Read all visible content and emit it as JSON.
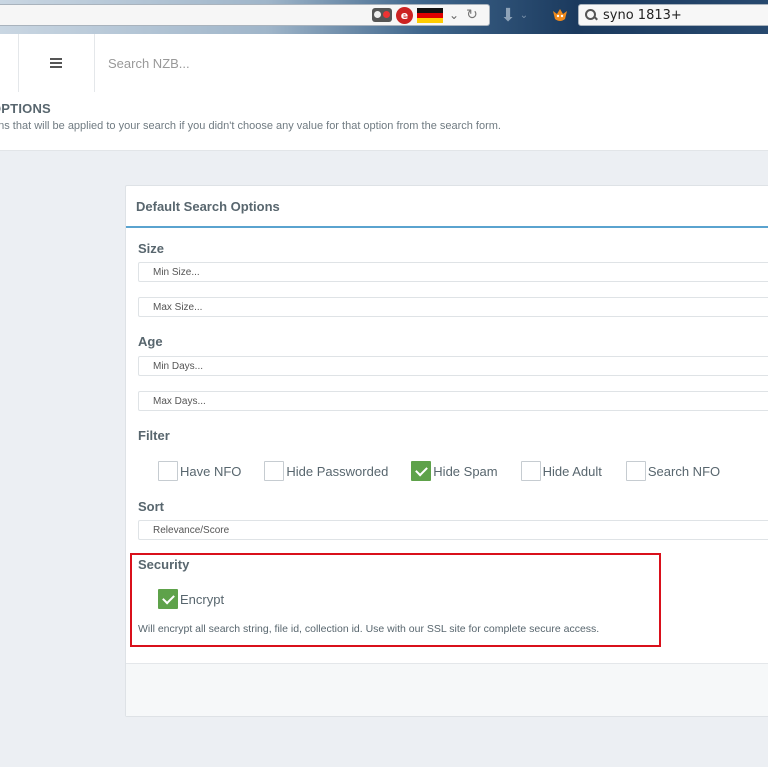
{
  "browser": {
    "search_query": "syno 1813+",
    "icons": [
      "glasses-icon",
      "badge-icon",
      "germany-flag-icon",
      "chevron-down-icon",
      "reload-icon",
      "download-arrow-icon",
      "fox-icon",
      "search-icon"
    ],
    "badge_letter": "e",
    "reload_glyph": "↻",
    "chevron_glyph": "⌄",
    "download_glyph": "⬇",
    "sep_glyph": "⌄"
  },
  "header": {
    "search_placeholder": "Search NZB..."
  },
  "page": {
    "title": "OPTIONS",
    "subtitle": "ons that will be applied to your search if you didn't choose any value for that option from the search form."
  },
  "panel": {
    "title": "Default Search Options",
    "size": {
      "label": "Size",
      "min_placeholder": "Min Size...",
      "max_placeholder": "Max Size..."
    },
    "age": {
      "label": "Age",
      "min_placeholder": "Min Days...",
      "max_placeholder": "Max Days..."
    },
    "filter": {
      "label": "Filter",
      "options": [
        {
          "label": "Have NFO",
          "checked": false
        },
        {
          "label": "Hide Passworded",
          "checked": false
        },
        {
          "label": "Hide Spam",
          "checked": true
        },
        {
          "label": "Hide Adult",
          "checked": false
        },
        {
          "label": "Search NFO",
          "checked": false
        }
      ]
    },
    "sort": {
      "label": "Sort",
      "value": "Relevance/Score"
    },
    "security": {
      "label": "Security",
      "encrypt_label": "Encrypt",
      "encrypt_checked": true,
      "hint": "Will encrypt all search string, file id, collection id. Use with our SSL site for complete secure access."
    }
  },
  "colors": {
    "accent_blue": "#5aa3cf",
    "check_green": "#5ea24a",
    "highlight_red": "#d9101b"
  }
}
